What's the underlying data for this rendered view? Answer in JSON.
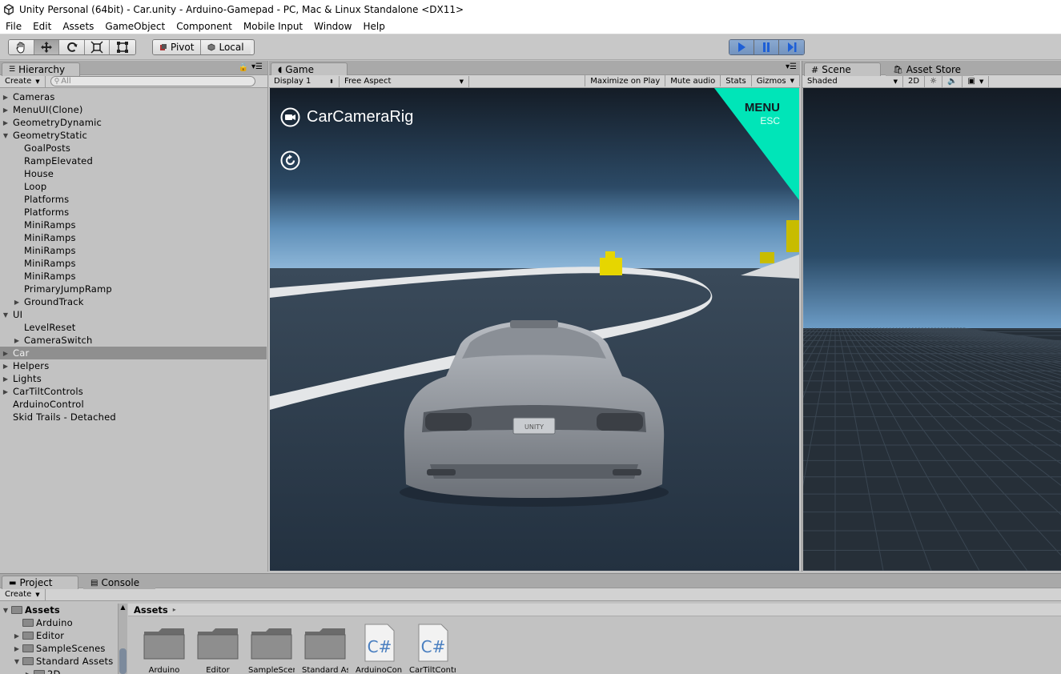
{
  "window": {
    "title": "Unity Personal (64bit) - Car.unity - Arduino-Gamepad - PC, Mac & Linux Standalone <DX11>"
  },
  "menu": [
    "File",
    "Edit",
    "Assets",
    "GameObject",
    "Component",
    "Mobile Input",
    "Window",
    "Help"
  ],
  "toolbar": {
    "tools": [
      "hand-icon",
      "move-icon",
      "rotate-icon",
      "scale-icon",
      "rect-icon"
    ],
    "pivot_label": "Pivot",
    "local_label": "Local"
  },
  "hierarchy": {
    "tab": "Hierarchy",
    "create": "Create",
    "search_placeholder": "All",
    "items": [
      {
        "label": "Cameras",
        "indent": 0,
        "arrow": "right"
      },
      {
        "label": "MenuUI(Clone)",
        "indent": 0,
        "arrow": "right"
      },
      {
        "label": "GeometryDynamic",
        "indent": 0,
        "arrow": "right"
      },
      {
        "label": "GeometryStatic",
        "indent": 0,
        "arrow": "down"
      },
      {
        "label": "GoalPosts",
        "indent": 1,
        "arrow": ""
      },
      {
        "label": "RampElevated",
        "indent": 1,
        "arrow": ""
      },
      {
        "label": "House",
        "indent": 1,
        "arrow": ""
      },
      {
        "label": "Loop",
        "indent": 1,
        "arrow": ""
      },
      {
        "label": "Platforms",
        "indent": 1,
        "arrow": ""
      },
      {
        "label": "Platforms",
        "indent": 1,
        "arrow": ""
      },
      {
        "label": "MiniRamps",
        "indent": 1,
        "arrow": ""
      },
      {
        "label": "MiniRamps",
        "indent": 1,
        "arrow": ""
      },
      {
        "label": "MiniRamps",
        "indent": 1,
        "arrow": ""
      },
      {
        "label": "MiniRamps",
        "indent": 1,
        "arrow": ""
      },
      {
        "label": "MiniRamps",
        "indent": 1,
        "arrow": ""
      },
      {
        "label": "PrimaryJumpRamp",
        "indent": 1,
        "arrow": ""
      },
      {
        "label": "GroundTrack",
        "indent": 1,
        "arrow": "right"
      },
      {
        "label": "UI",
        "indent": 0,
        "arrow": "down"
      },
      {
        "label": "LevelReset",
        "indent": 1,
        "arrow": ""
      },
      {
        "label": "CameraSwitch",
        "indent": 1,
        "arrow": "right"
      },
      {
        "label": "Car",
        "indent": 0,
        "arrow": "right",
        "selected": true
      },
      {
        "label": "Helpers",
        "indent": 0,
        "arrow": "right"
      },
      {
        "label": "Lights",
        "indent": 0,
        "arrow": "right"
      },
      {
        "label": "CarTiltControls",
        "indent": 0,
        "arrow": "right"
      },
      {
        "label": "ArduinoControl",
        "indent": 0,
        "arrow": ""
      },
      {
        "label": "Skid Trails - Detached",
        "indent": 0,
        "arrow": ""
      }
    ]
  },
  "game": {
    "tab": "Game",
    "display": "Display 1",
    "aspect": "Free Aspect",
    "maximize": "Maximize on Play",
    "mute": "Mute audio",
    "stats": "Stats",
    "gizmos": "Gizmos",
    "camera_label": "CarCameraRig",
    "menu_label": "MENU",
    "menu_sub": "ESC",
    "plate_text": "UNITY"
  },
  "scene": {
    "tab": "Scene",
    "asset_store_tab": "Asset Store",
    "shading": "Shaded",
    "mode_2d": "2D"
  },
  "project": {
    "tab": "Project",
    "console_tab": "Console",
    "create": "Create",
    "tree": [
      {
        "label": "Assets",
        "indent": 0,
        "arrow": "down",
        "bold": true
      },
      {
        "label": "Arduino",
        "indent": 1,
        "arrow": ""
      },
      {
        "label": "Editor",
        "indent": 1,
        "arrow": "right"
      },
      {
        "label": "SampleScenes",
        "indent": 1,
        "arrow": "right"
      },
      {
        "label": "Standard Assets",
        "indent": 1,
        "arrow": "down"
      },
      {
        "label": "2D",
        "indent": 2,
        "arrow": "right"
      }
    ],
    "breadcrumb": "Assets",
    "grid_items": [
      {
        "type": "folder",
        "label": "Arduino"
      },
      {
        "type": "folder",
        "label": "Editor"
      },
      {
        "type": "folder",
        "label": "SampleScenes"
      },
      {
        "type": "folder",
        "label": "Standard Assets"
      },
      {
        "type": "script",
        "label": "ArduinoControl"
      },
      {
        "type": "script",
        "label": "CarTiltControls"
      }
    ]
  },
  "colors": {
    "accent_menu": "#00e5b8",
    "play_blue": "#7d9cc7",
    "selection": "#8f8f8f"
  }
}
